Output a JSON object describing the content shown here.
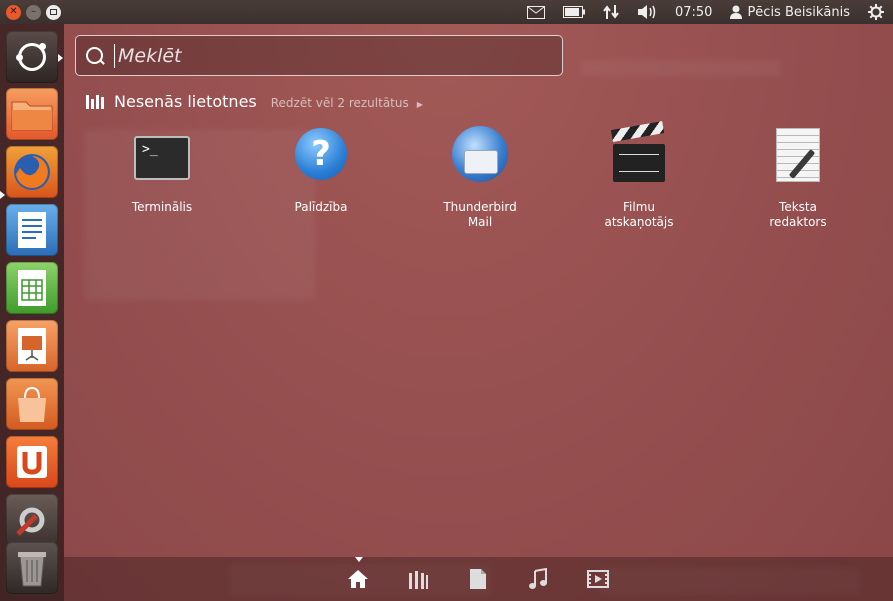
{
  "top_panel": {
    "clock": "07:50",
    "user_name": "Pēcis Beisikānis",
    "icons": [
      "mail-icon",
      "battery-icon",
      "network-icon",
      "volume-icon",
      "user-icon",
      "gear-icon"
    ]
  },
  "launcher": {
    "items": [
      {
        "name": "dash-home",
        "icon": "ubuntu-logo-icon"
      },
      {
        "name": "files",
        "icon": "folder-icon"
      },
      {
        "name": "firefox",
        "icon": "firefox-icon"
      },
      {
        "name": "writer",
        "icon": "writer-icon"
      },
      {
        "name": "calc",
        "icon": "calc-icon"
      },
      {
        "name": "impress",
        "icon": "impress-icon"
      },
      {
        "name": "software-center",
        "icon": "shopping-bag-icon"
      },
      {
        "name": "ubuntu-one",
        "icon": "ubuntu-one-icon"
      },
      {
        "name": "system-settings",
        "icon": "settings-icon"
      },
      {
        "name": "trash",
        "icon": "trash-icon"
      }
    ]
  },
  "search": {
    "placeholder": "Meklēt",
    "value": ""
  },
  "category": {
    "title": "Nesenās lietotnes",
    "more": "Redzēt vēl 2 rezultātus"
  },
  "apps": [
    {
      "label": "Terminālis",
      "icon": "terminal-icon"
    },
    {
      "label": "Palīdzība",
      "icon": "help-icon"
    },
    {
      "label": "Thunderbird Mail",
      "icon": "thunderbird-icon"
    },
    {
      "label": "Filmu atskaņotājs",
      "icon": "clapperboard-icon"
    },
    {
      "label": "Teksta redaktors",
      "icon": "text-editor-icon"
    }
  ],
  "lenses": [
    {
      "name": "home",
      "icon": "home-icon",
      "active": true
    },
    {
      "name": "applications",
      "icon": "applications-icon",
      "active": false
    },
    {
      "name": "files",
      "icon": "file-icon",
      "active": false
    },
    {
      "name": "music",
      "icon": "music-icon",
      "active": false
    },
    {
      "name": "video",
      "icon": "video-icon",
      "active": false
    }
  ],
  "colors": {
    "launcher_bg": "#321e1e",
    "accent": "#e8592b",
    "dash_tint": "#964e4e"
  }
}
